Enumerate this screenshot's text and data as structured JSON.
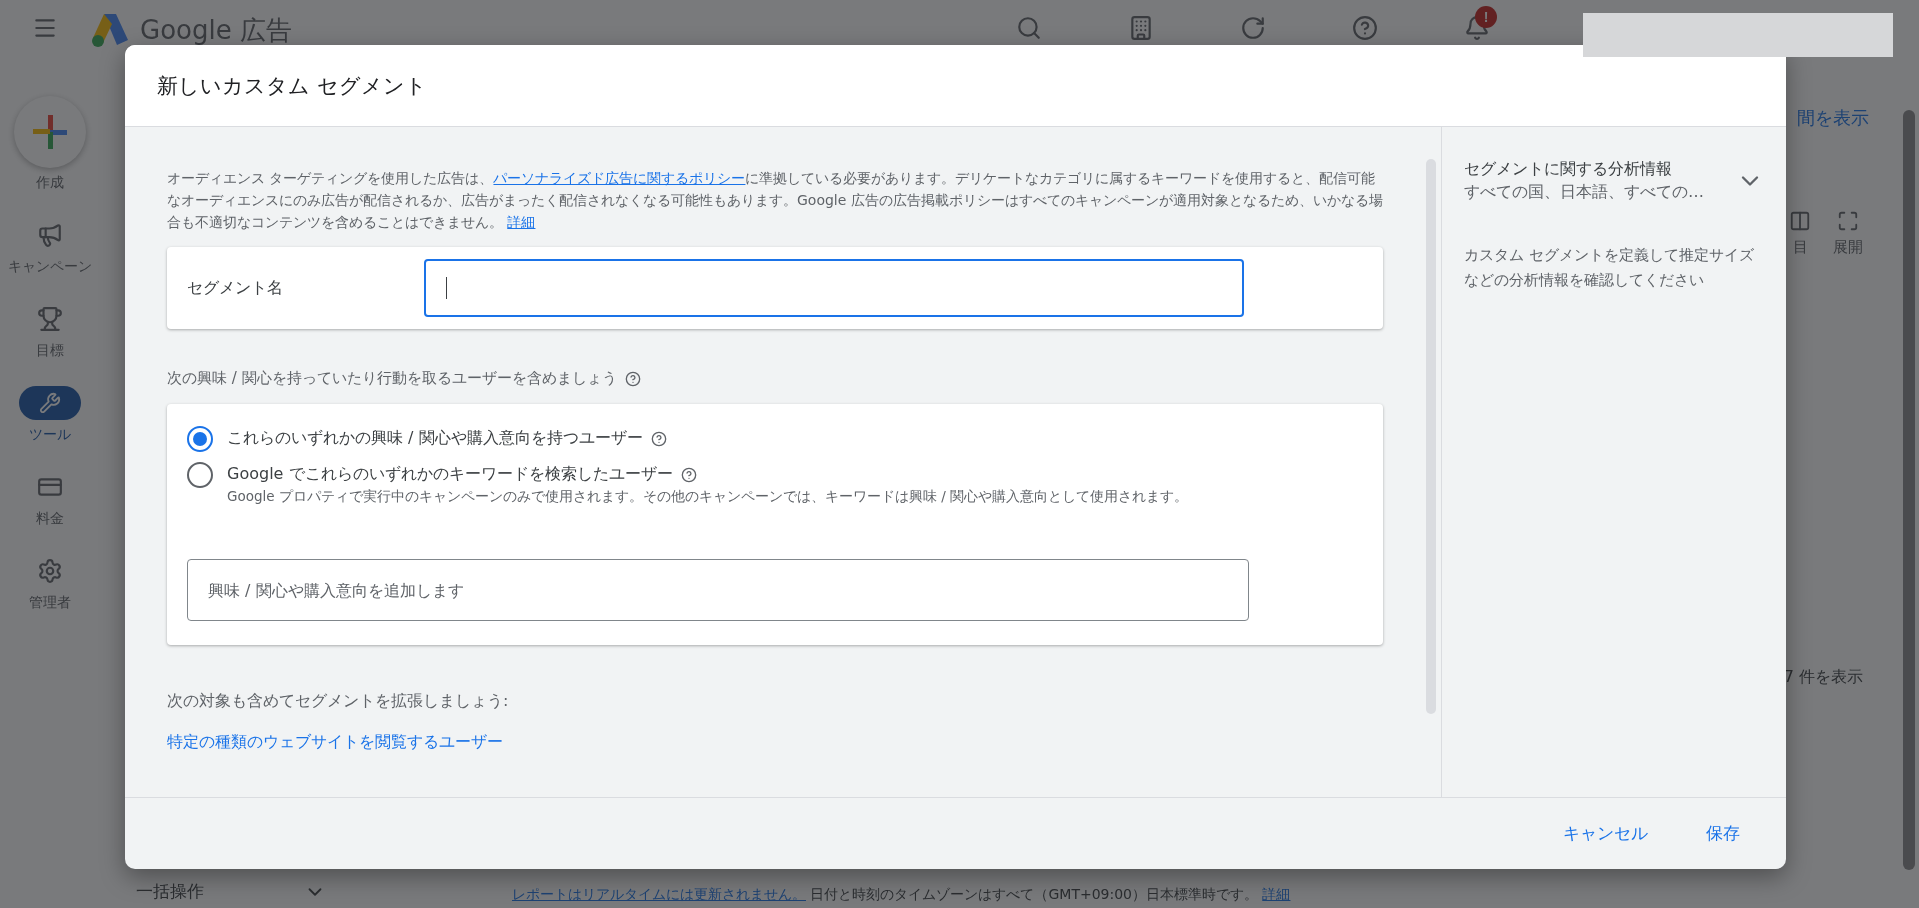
{
  "app_bar": {
    "product_name": "Google 広告",
    "notification_badge": "!"
  },
  "nav": [
    {
      "label": "作成",
      "kind": "create",
      "selected": false
    },
    {
      "label": "キャンペーン",
      "kind": "campaign",
      "selected": false
    },
    {
      "label": "目標",
      "kind": "goal",
      "selected": false
    },
    {
      "label": "ツール",
      "kind": "tools",
      "selected": true
    },
    {
      "label": "料金",
      "kind": "billing",
      "selected": false
    },
    {
      "label": "管理者",
      "kind": "admin",
      "selected": false
    }
  ],
  "background": {
    "view_link": "間を表示",
    "toolbar": [
      {
        "label": "目",
        "kind": "columns"
      },
      {
        "label": "展開",
        "kind": "expand"
      }
    ],
    "rows_shown": "7 件を表示",
    "bulk_actions": "一括操作",
    "footer_note": "レポートはリアルタイムには更新されません。",
    "footer_text": "日付と時刻のタイムゾーンはすべて（GMT+09:00）日本標準時です。",
    "footer_link": "詳細"
  },
  "dialog": {
    "title": "新しいカスタム セグメント",
    "policy": {
      "before": "オーディエンス ターゲティングを使用した広告は、",
      "link": "パーソナライズド広告に関するポリシー",
      "after": "に準拠している必要があります。デリケートなカテゴリに属するキーワードを使用すると、配信可能なオーディエンスにのみ広告が配信されるか、広告がまったく配信されなくなる可能性もあります。Google 広告の広告掲載ポリシーはすべてのキャンペーンが適用対象となるため、いかなる場合も不適切なコンテンツを含めることはできません。",
      "more_link": "詳細"
    },
    "segment_name": {
      "label": "セグメント名",
      "focused": true
    },
    "include_heading": "次の興味 / 関心を持っていたり行動を取るユーザーを含めましょう",
    "options": [
      {
        "label": "これらのいずれかの興味 / 関心や購入意向を持つユーザー",
        "selected": true
      },
      {
        "label": "Google でこれらのいずれかのキーワードを検索したユーザー",
        "description": "Google プロパティで実行中のキャンペーンのみで使用されます。その他のキャンペーンでは、キーワードは興味 / 関心や購入意向として使用されます。",
        "selected": false
      }
    ],
    "interest_input": {
      "placeholder": "興味 / 関心や購入意向を追加します"
    },
    "expand_heading": "次の対象も含めてセグメントを拡張しましょう:",
    "expand_link": "特定の種類のウェブサイトを閲覧するユーザー",
    "insights": {
      "title": "セグメントに関する分析情報",
      "subtitle": "すべての国、日本語、すべての…",
      "expanded": false,
      "description": "カスタム セグメントを定義して推定サイズなどの分析情報を確認してください"
    },
    "buttons": [
      {
        "label": "キャンセル"
      },
      {
        "label": "保存"
      }
    ]
  }
}
